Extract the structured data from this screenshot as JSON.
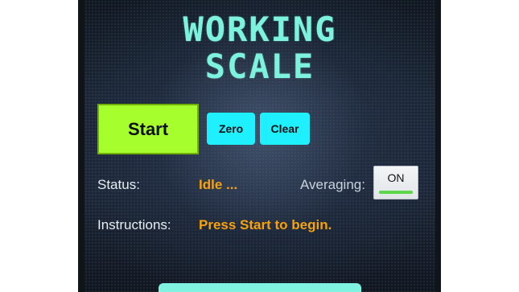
{
  "app": {
    "title_line1": "WORKING",
    "title_line2": "SCALE"
  },
  "buttons": {
    "start_label": "Start",
    "zero_label": "Zero",
    "clear_label": "Clear"
  },
  "status": {
    "label": "Status:",
    "value": "Idle ..."
  },
  "averaging": {
    "label": "Averaging:",
    "toggle_state": "ON"
  },
  "instructions": {
    "label": "Instructions:",
    "value": "Press Start to begin."
  },
  "colors": {
    "title": "#7df2dc",
    "start_button": "#a6ff2c",
    "secondary_buttons": "#1ff0ff",
    "status_value": "#f6a20c",
    "toggle_on_indicator": "#5ad84a"
  }
}
